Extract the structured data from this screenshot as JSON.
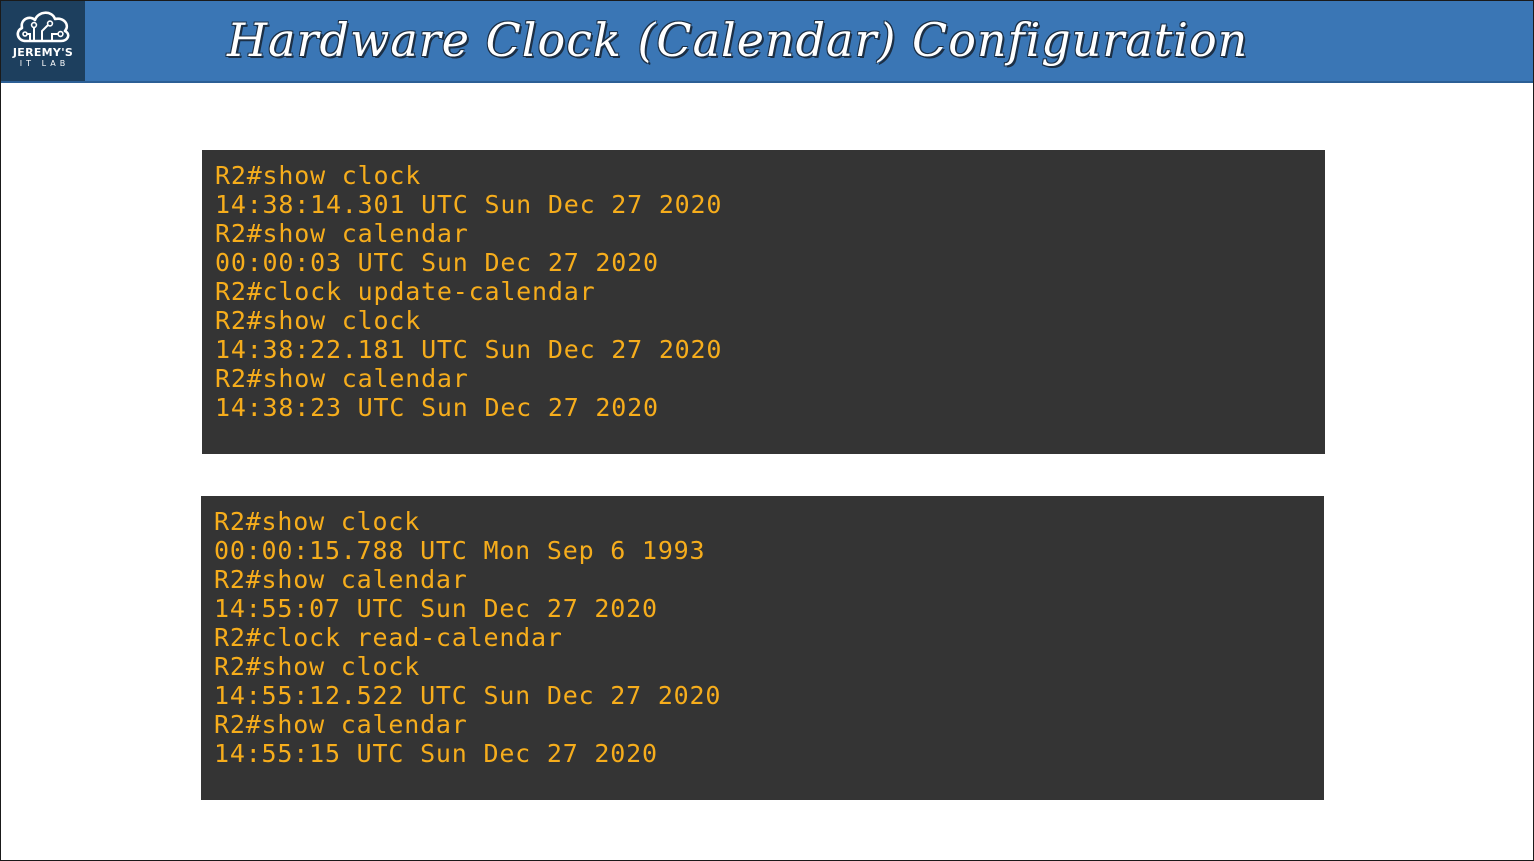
{
  "header": {
    "title": "Hardware Clock (Calendar) Configuration",
    "logo": {
      "icon": "cloud-circuit-icon",
      "name": "JEREMY'S",
      "sub": "IT LAB"
    },
    "colors": {
      "bar": "#3a76b5",
      "logo_bg": "#1d3f5e"
    }
  },
  "terminals": [
    {
      "lines": [
        "R2#show clock",
        "14:38:14.301 UTC Sun Dec 27 2020",
        "R2#show calendar",
        "00:00:03 UTC Sun Dec 27 2020",
        "R2#clock update-calendar",
        "R2#show clock",
        "14:38:22.181 UTC Sun Dec 27 2020",
        "R2#show calendar",
        "14:38:23 UTC Sun Dec 27 2020"
      ]
    },
    {
      "lines": [
        "R2#show clock",
        "00:00:15.788 UTC Mon Sep 6 1993",
        "R2#show calendar",
        "14:55:07 UTC Sun Dec 27 2020",
        "R2#clock read-calendar",
        "R2#show clock",
        "14:55:12.522 UTC Sun Dec 27 2020",
        "R2#show calendar",
        "14:55:15 UTC Sun Dec 27 2020"
      ]
    }
  ],
  "colors": {
    "terminal_bg": "#343434",
    "terminal_text": "#f6ad1c"
  }
}
